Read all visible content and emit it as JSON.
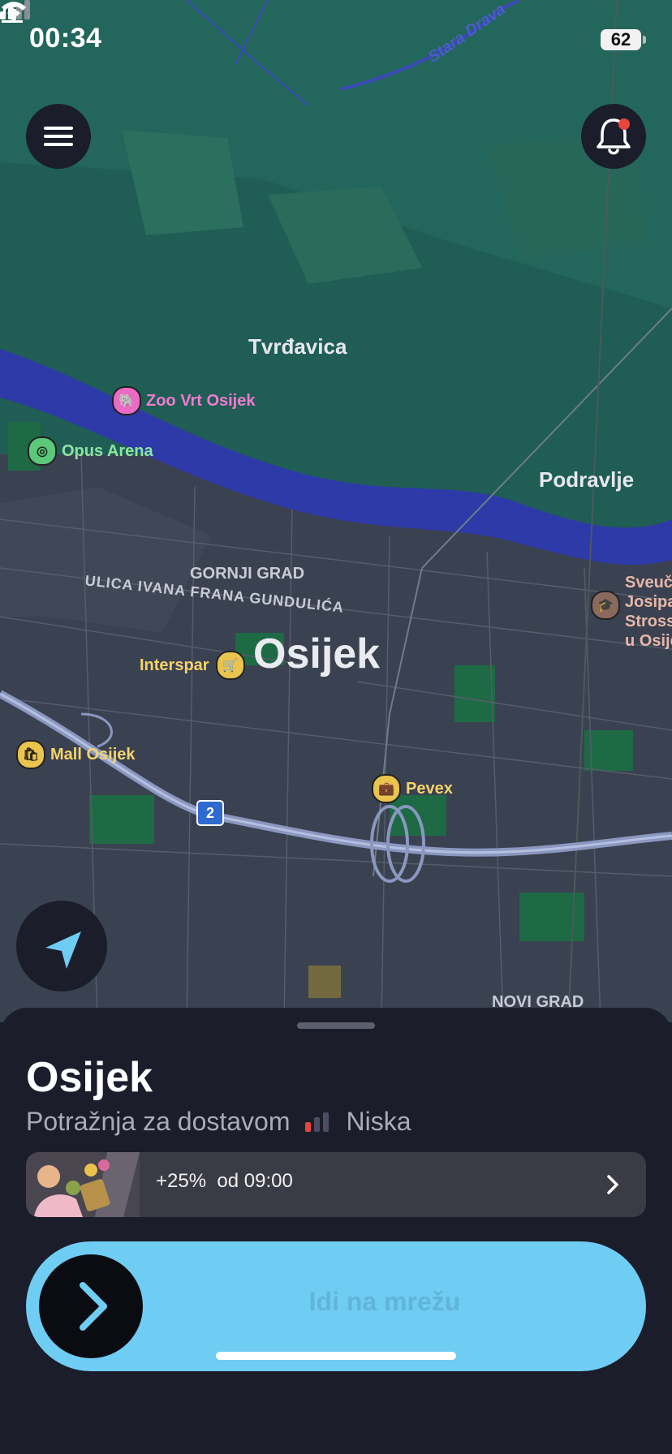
{
  "status_bar": {
    "time": "00:34",
    "battery": "62"
  },
  "map": {
    "labels": {
      "stara_drava": "Stara Drava",
      "tvrdavica": "Tvrđavica",
      "podravlje": "Podravlje",
      "gornji_grad": "GORNJI GRAD",
      "street": "ULICA IVANA FRANA GUNDULIĆA",
      "city": "Osijek",
      "novi_grad": "NOVI GRAD",
      "university": [
        "Sveuč",
        "Josipa",
        "Stross",
        "u Osije"
      ],
      "road_shield": "2"
    },
    "pois": [
      {
        "name": "Zoo Vrt Osijek",
        "icon": "elephant-icon"
      },
      {
        "name": "Opus Arena",
        "icon": "stadium-icon"
      },
      {
        "name": "Interspar",
        "icon": "cart-icon"
      },
      {
        "name": "Mall Osijek",
        "icon": "shopping-bag-icon"
      },
      {
        "name": "Pevex",
        "icon": "briefcase-icon"
      }
    ]
  },
  "sheet": {
    "title": "Osijek",
    "demand_label": "Potražnja za dostavom",
    "demand_level": "Niska",
    "demand_bars_filled": 1,
    "promo": {
      "bonus": "+25%",
      "time": "od 09:00"
    },
    "go_online_label": "Idi na mrežu"
  },
  "colors": {
    "accent": "#6fcdf3",
    "sheet_bg": "#1b1d2b",
    "map_green": "#1f5d55",
    "river": "#2e3aa8",
    "notification_dot": "#e8453c",
    "demand_low": "#e8453c"
  }
}
